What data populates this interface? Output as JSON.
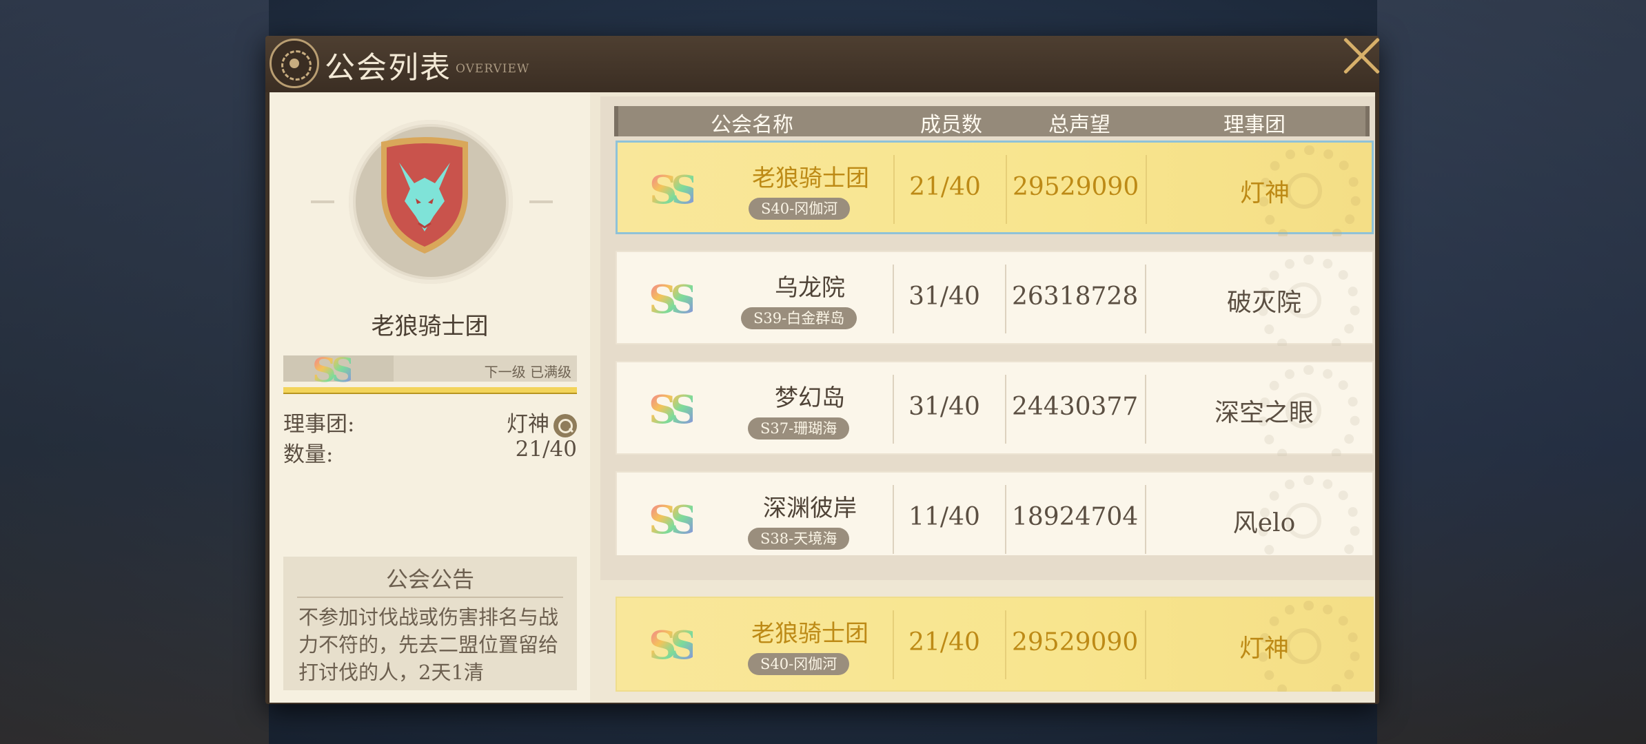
{
  "window": {
    "title": "公会列表",
    "subtitle": "OVERVIEW"
  },
  "selected_guild": {
    "name": "老狼骑士团",
    "grade": "SS",
    "next_level_label": "下一级 已满级",
    "level_progress": 1.0,
    "council_label": "理事团:",
    "council_value": "灯神",
    "count_label": "数量:",
    "count_value": "21/40",
    "notice_title": "公会公告",
    "notice_body": "不参加讨伐战或伤害排名与战力不符的，先去二盟位置留给打讨伐的人，2天1清"
  },
  "table": {
    "headers": {
      "name": "公会名称",
      "members": "成员数",
      "prestige": "总声望",
      "council": "理事团"
    },
    "rows": [
      {
        "grade": "SS",
        "name": "老狼骑士团",
        "server": "S40-冈伽河",
        "members": "21/40",
        "prestige": "29529090",
        "council": "灯神",
        "selected": true
      },
      {
        "grade": "SS",
        "name": "乌龙院",
        "server": "S39-白金群岛",
        "members": "31/40",
        "prestige": "26318728",
        "council": "破灭院",
        "selected": false
      },
      {
        "grade": "SS",
        "name": "梦幻岛",
        "server": "S37-珊瑚海",
        "members": "31/40",
        "prestige": "24430377",
        "council": "深空之眼",
        "selected": false
      },
      {
        "grade": "SS",
        "name": "深渊彼岸",
        "server": "S38-天境海",
        "members": "11/40",
        "prestige": "18924704",
        "council": "风elo",
        "selected": false
      }
    ],
    "my_guild": {
      "grade": "SS",
      "name": "老狼骑士团",
      "server": "S40-冈伽河",
      "members": "21/40",
      "prestige": "29529090",
      "council": "灯神"
    }
  },
  "colors": {
    "accent_gold": "#bd8a16",
    "selected_row": "#f9e79a",
    "panel_dark": "#3f3226"
  },
  "icons": [
    "guild-emblem-icon",
    "close-icon",
    "wolf-shield-icon",
    "search-icon",
    "gear-watermark-icon"
  ]
}
